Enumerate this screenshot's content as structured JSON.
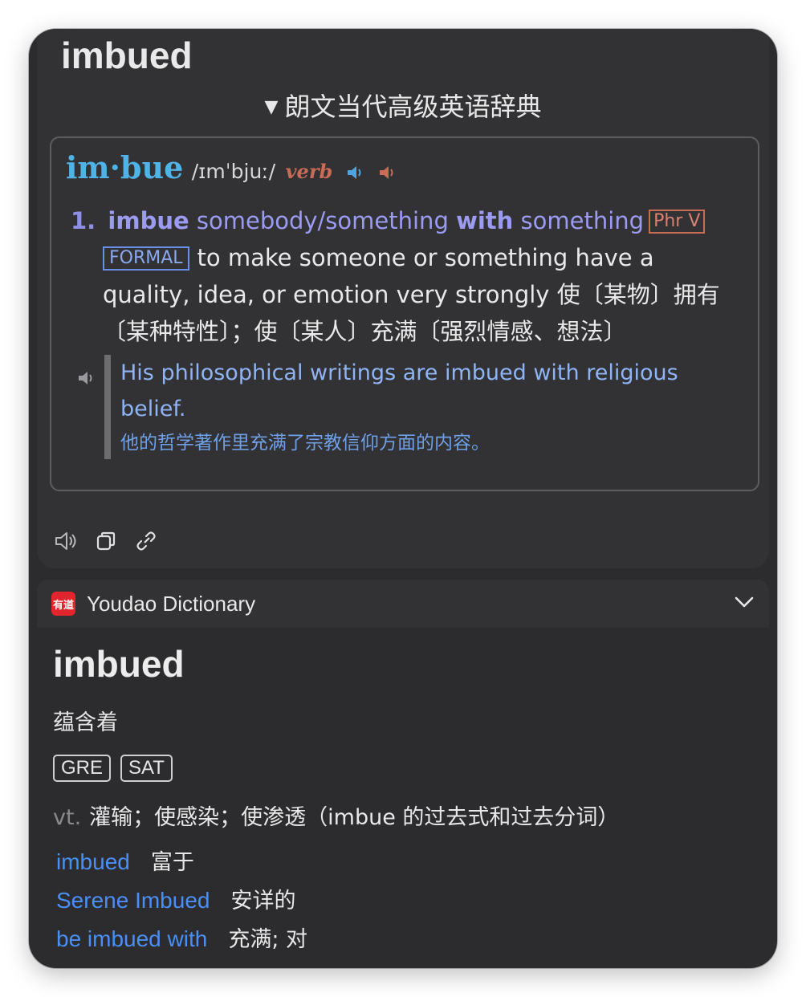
{
  "top": {
    "headword": "imbued",
    "dict_title": "朗文当代高级英语辞典",
    "entry": {
      "headword": "im·bue",
      "pron": "/ɪmˈbjuː/",
      "pos": "verb",
      "sense_number": "1.",
      "pattern_word": "imbue",
      "pattern_obj": "somebody/something",
      "pattern_with": "with",
      "pattern_obj2": "something",
      "tag_phrv": "Phr V",
      "tag_formal": "FORMAL",
      "definition_en_1": "to make someone or something have a",
      "definition_en_2": "quality, idea, or emotion very strongly",
      "definition_zh_1": "使〔某物〕拥有",
      "definition_zh_2": "〔某种特性〕；使〔某人〕充满〔强烈情感、想法〕",
      "example_en": "His philosophical writings are imbued with religious belief.",
      "example_zh": "他的哲学著作里充满了宗教信仰方面的内容。"
    },
    "actions": [
      "speaker-icon",
      "copy-icon",
      "link-icon"
    ]
  },
  "youdao": {
    "logo_text": "有道",
    "name": "Youdao Dictionary",
    "word": "imbued",
    "translation": "蕴含着",
    "tags": [
      "GRE",
      "SAT"
    ],
    "pos": "vt.",
    "definition": "灌输；使感染；使渗透（imbue 的过去式和过去分词）",
    "phrases": [
      {
        "en": "imbued",
        "zh": "富于"
      },
      {
        "en": "Serene Imbued",
        "zh": "安详的"
      },
      {
        "en": "be imbued with",
        "zh": "充满; 对"
      }
    ]
  },
  "colors": {
    "background": "#2c2c2e",
    "headword_blue": "#4fb3e8",
    "pattern_purple": "#9b9bf2",
    "pos_red": "#c86b57",
    "link_blue": "#4a8ff5",
    "youdao_red": "#e3262d"
  }
}
